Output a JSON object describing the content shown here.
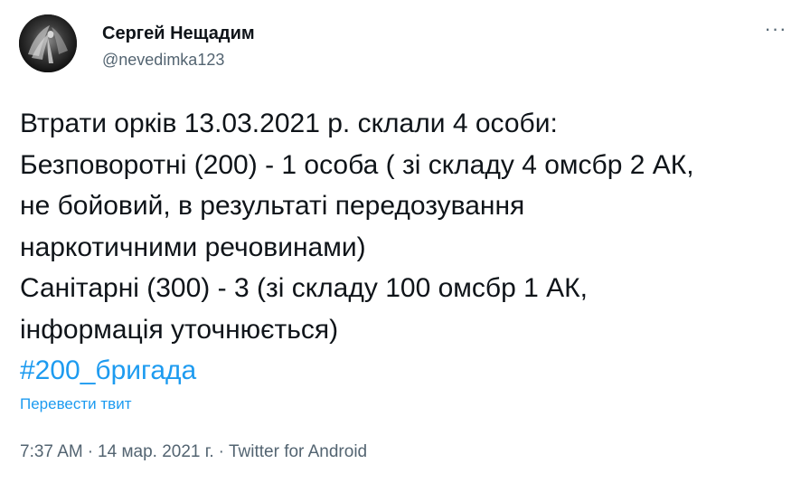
{
  "author": {
    "name": "Сергей Нещадим",
    "handle": "@nevedimka123",
    "avatar_icon": "angel-figure-avatar"
  },
  "more_button": {
    "label": "···",
    "icon": "more-horizontal-icon"
  },
  "tweet": {
    "lines": [
      "Втрати орків 13.03.2021 р. склали 4 особи:",
      "Безповоротні (200) - 1 особа ( зі складу 4 омсбр 2 АК,",
      "не бойовий, в результаті передозування",
      "наркотичними речовинами)",
      "Санітарні (300) - 3 (зі складу 100 омсбр 1 АК,",
      "інформація уточнюється)"
    ],
    "hashtag": "#200_бригада"
  },
  "translate_label": "Перевести твит",
  "meta": {
    "time": "7:37 AM",
    "separator": "·",
    "date": "14 мар. 2021 г.",
    "source": "Twitter for Android"
  },
  "colors": {
    "text": "#0f1419",
    "secondary": "#536471",
    "link": "#1d9bf0",
    "background": "#ffffff"
  }
}
